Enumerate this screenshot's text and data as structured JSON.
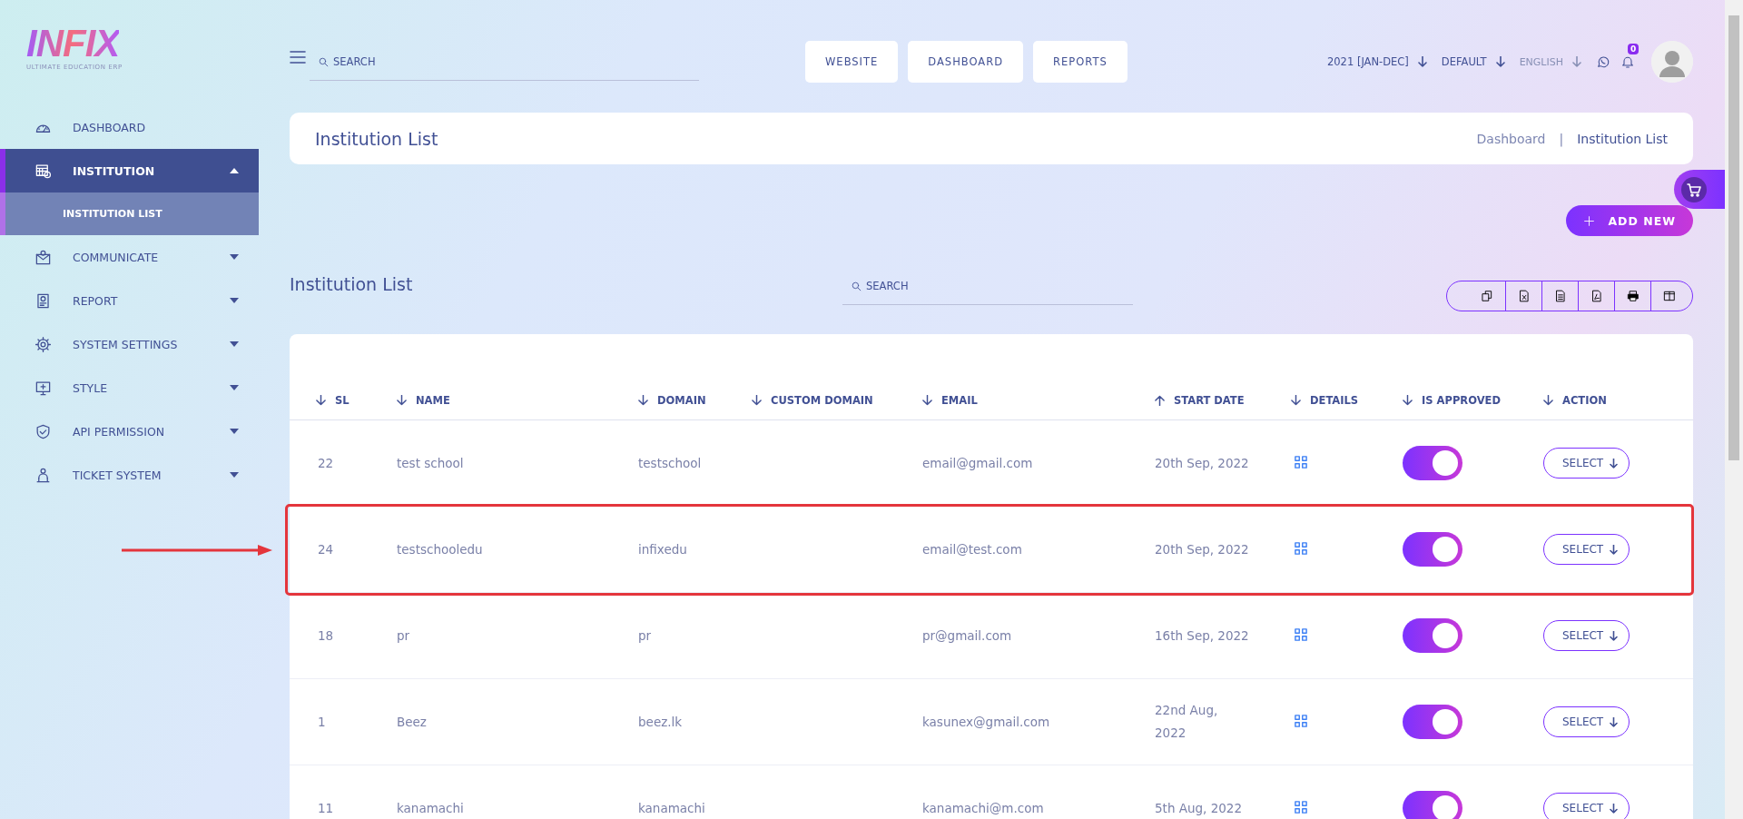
{
  "logo": {
    "wordmark": "INFIX",
    "tagline": "ULTIMATE EDUCATION ERP"
  },
  "sidebar": {
    "items": [
      {
        "kind": "link",
        "label": "DASHBOARD",
        "selected": false
      },
      {
        "kind": "group",
        "label": "INSTITUTION",
        "selected": true,
        "expanded": true,
        "children": [
          {
            "label": "INSTITUTION LIST",
            "selected": true
          }
        ]
      },
      {
        "kind": "group",
        "label": "COMMUNICATE",
        "selected": false,
        "expanded": false
      },
      {
        "kind": "group",
        "label": "REPORT",
        "selected": false,
        "expanded": false
      },
      {
        "kind": "group",
        "label": "SYSTEM SETTINGS",
        "selected": false,
        "expanded": false
      },
      {
        "kind": "group",
        "label": "STYLE",
        "selected": false,
        "expanded": false
      },
      {
        "kind": "group",
        "label": "API PERMISSION",
        "selected": false,
        "expanded": false
      },
      {
        "kind": "group",
        "label": "TICKET SYSTEM",
        "selected": false,
        "expanded": false
      }
    ]
  },
  "topbar": {
    "search": {
      "placeholder": "SEARCH"
    },
    "nav_buttons": [
      "WEBSITE",
      "DASHBOARD",
      "REPORTS"
    ],
    "dropdowns": [
      {
        "label": "2021 [JAN-DEC]",
        "muted": false
      },
      {
        "label": "DEFAULT",
        "muted": false
      },
      {
        "label": "ENGLISH",
        "muted": true
      }
    ],
    "notification_count": "0"
  },
  "page_header": {
    "title": "Institution List",
    "breadcrumb_separator": "|",
    "breadcrumb": [
      {
        "label": "Dashboard",
        "current": false
      },
      {
        "label": "Institution List",
        "current": true
      }
    ]
  },
  "add_button": "ADD NEW",
  "list": {
    "title": "Institution List",
    "search": {
      "placeholder": "SEARCH"
    },
    "export_buttons": [
      {
        "kind": "copy"
      },
      {
        "kind": "excel"
      },
      {
        "kind": "csv"
      },
      {
        "kind": "pdf"
      },
      {
        "kind": "print"
      },
      {
        "kind": "columns"
      }
    ],
    "table": {
      "columns": [
        {
          "label": "SL",
          "ascending": false
        },
        {
          "label": "NAME",
          "ascending": false
        },
        {
          "label": "DOMAIN",
          "ascending": false
        },
        {
          "label": "CUSTOM DOMAIN",
          "ascending": false
        },
        {
          "label": "EMAIL",
          "ascending": false
        },
        {
          "label": "START DATE",
          "ascending": true
        },
        {
          "label": "DETAILS",
          "ascending": false
        },
        {
          "label": "IS APPROVED",
          "ascending": false
        },
        {
          "label": "ACTION",
          "ascending": false
        }
      ],
      "rows": [
        {
          "sl": "22",
          "name": "test school",
          "domain": "testschool",
          "email": "email@gmail.com",
          "start_date": "20th Sep, 2022",
          "approved": true,
          "action": "SELECT",
          "highlighted": false
        },
        {
          "sl": "24",
          "name": "testschooledu",
          "domain": "infixedu",
          "email": "email@test.com",
          "start_date": "20th Sep, 2022",
          "approved": true,
          "action": "SELECT",
          "highlighted": true
        },
        {
          "sl": "18",
          "name": "pr",
          "domain": "pr",
          "email": "pr@gmail.com",
          "start_date": "16th Sep, 2022",
          "approved": true,
          "action": "SELECT",
          "highlighted": false
        },
        {
          "sl": "1",
          "name": "Beez",
          "domain": "beez.lk",
          "email": "kasunex@gmail.com",
          "start_date": "22nd Aug, 2022",
          "approved": true,
          "action": "SELECT",
          "highlighted": false
        },
        {
          "sl": "11",
          "name": "kanamachi",
          "domain": "kanamachi",
          "email": "kanamachi@m.com",
          "start_date": "5th Aug, 2022",
          "approved": true,
          "action": "SELECT",
          "highlighted": false
        }
      ]
    }
  }
}
